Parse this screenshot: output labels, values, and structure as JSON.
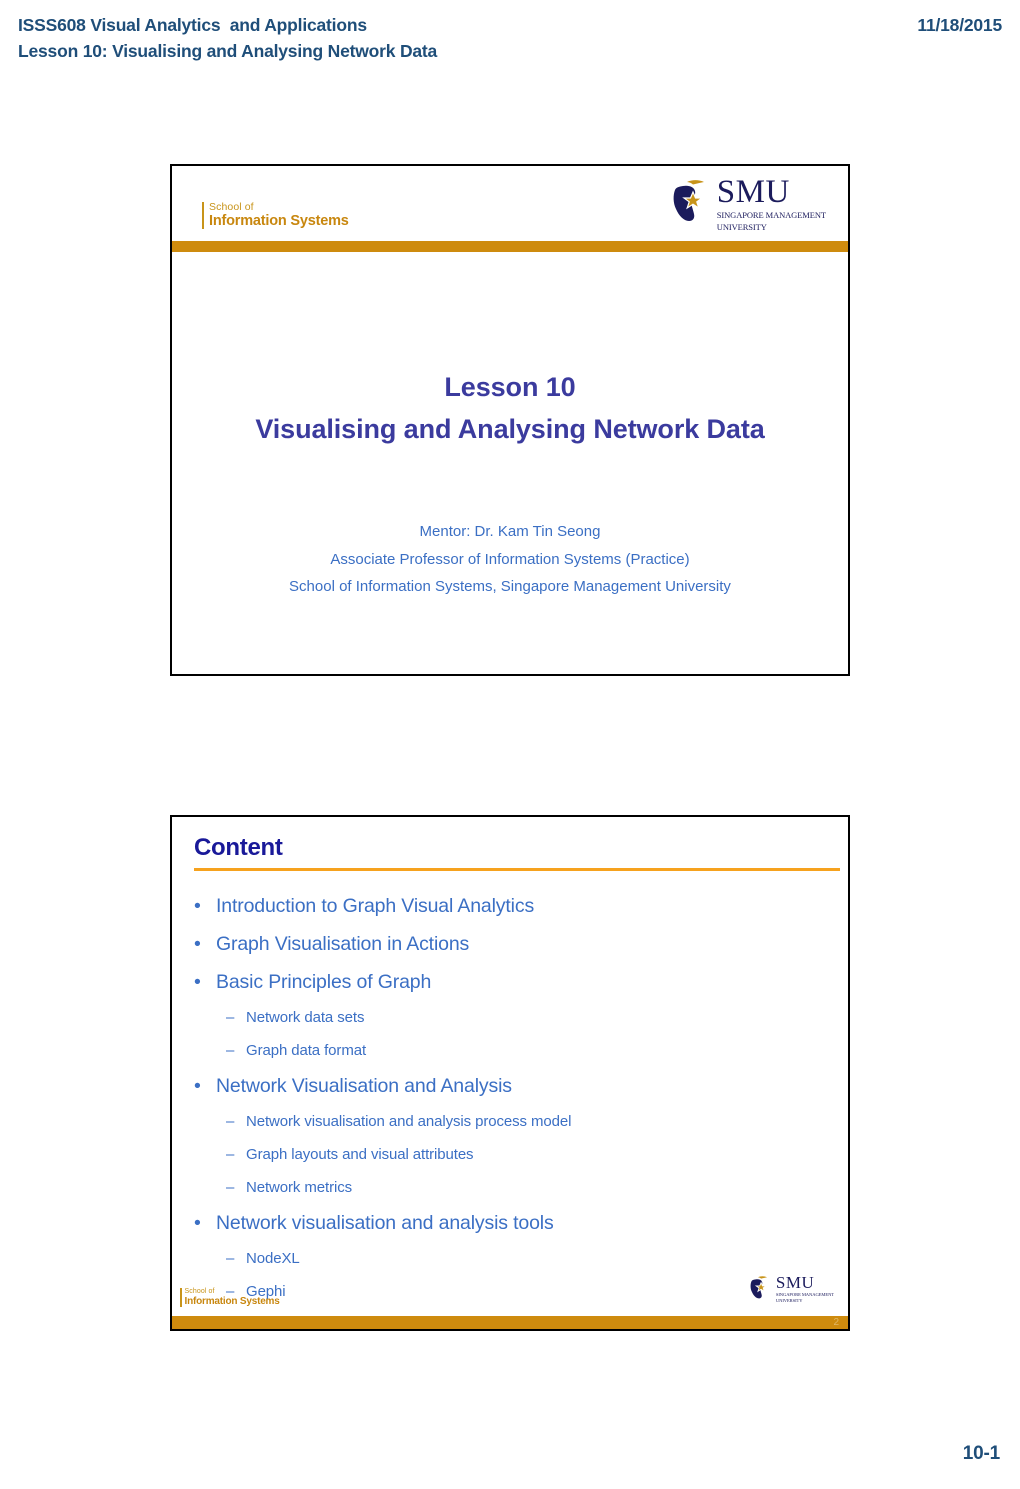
{
  "header": {
    "course_title": "ISSS608 Visual Analytics  and Applications",
    "lesson_line": "Lesson 10: Visualising and Analysing Network Data",
    "date": "11/18/2015"
  },
  "branding": {
    "sis_school_label": "School of",
    "sis_name_label": "Information Systems",
    "smu_abbrev": "SMU",
    "smu_full_line1": "SINGAPORE MANAGEMENT",
    "smu_full_line2": "UNIVERSITY",
    "gold": "#CE8B0E",
    "navy": "#1B1B5C",
    "accent_rule": "#F6A21E"
  },
  "slide_title": {
    "title_line1": "Lesson 10",
    "title_line2": "Visualising and Analysing Network Data",
    "credit_line1": "Mentor: Dr. Kam Tin Seong",
    "credit_line2": "Associate Professor of Information Systems (Practice)",
    "credit_line3": "School of Information Systems, Singapore Management University",
    "title_color": "#3B3B9E",
    "credit_color": "#3B6FC4"
  },
  "slide_content": {
    "heading": "Content",
    "page_number": "2",
    "bullet_marker": "•",
    "sub_marker": "–",
    "items": [
      {
        "level": 1,
        "text": "Introduction to Graph Visual Analytics"
      },
      {
        "level": 1,
        "text": "Graph Visualisation in Actions"
      },
      {
        "level": 1,
        "text": "Basic Principles of Graph"
      },
      {
        "level": 2,
        "text": "Network data sets"
      },
      {
        "level": 2,
        "text": "Graph data format"
      },
      {
        "level": 1,
        "text": "Network Visualisation and Analysis"
      },
      {
        "level": 2,
        "text": "Network visualisation and analysis process model"
      },
      {
        "level": 2,
        "text": "Graph layouts and visual attributes"
      },
      {
        "level": 2,
        "text": "Network metrics"
      },
      {
        "level": 1,
        "text": "Network visualisation and analysis tools"
      },
      {
        "level": 2,
        "text": "NodeXL"
      },
      {
        "level": 2,
        "text": "Gephi"
      }
    ]
  },
  "document_footer": {
    "page_label": "10-1"
  }
}
